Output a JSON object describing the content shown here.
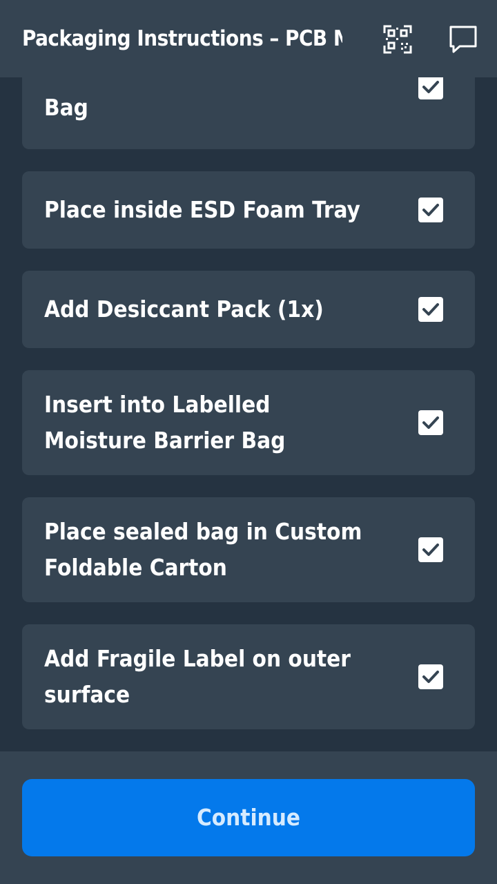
{
  "header": {
    "title": "Packaging Instructions – PCB Module",
    "icons": [
      "qr-code-icon",
      "chat-icon"
    ]
  },
  "steps": [
    {
      "label": "Bag",
      "checked": true
    },
    {
      "label": "Place inside ESD Foam Tray",
      "checked": true
    },
    {
      "label": "Add Desiccant Pack (1x)",
      "checked": true
    },
    {
      "label": "Insert into Labelled Moisture Barrier Bag",
      "checked": true
    },
    {
      "label": "Place sealed bag in Custom Foldable Carton",
      "checked": true
    },
    {
      "label": "Add Fragile Label on outer surface",
      "checked": true
    }
  ],
  "footer": {
    "continue_label": "Continue"
  },
  "colors": {
    "background": "#253341",
    "card": "#354452",
    "accent": "#0479eb",
    "button_text": "#d6ebff",
    "checkmark": "#354452"
  }
}
